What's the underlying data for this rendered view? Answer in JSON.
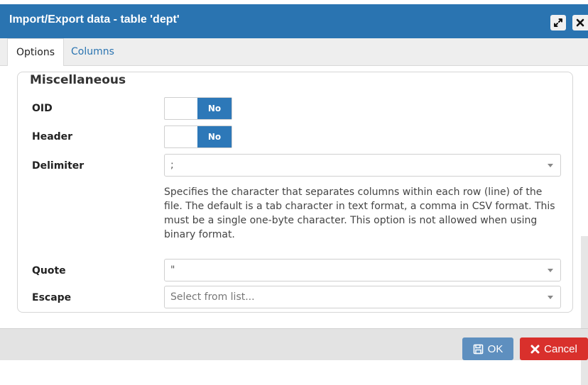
{
  "dialog": {
    "title": "Import/Export data - table 'dept'",
    "colors": {
      "titlebar": "#2a74b1",
      "accent": "#2d78b8",
      "cancel": "#d9302c",
      "ok": "#5e8fbf"
    }
  },
  "titlebar_buttons": [
    {
      "icon": "maximize-icon"
    },
    {
      "icon": "close-icon"
    }
  ],
  "tabs": [
    {
      "label": "Options",
      "active": true
    },
    {
      "label": "Columns",
      "active": false
    }
  ],
  "misc": {
    "legend": "Miscellaneous",
    "oid": {
      "label": "OID",
      "value": "No"
    },
    "header": {
      "label": "Header",
      "value": "No"
    },
    "delimiter": {
      "label": "Delimiter",
      "value": ";",
      "help": "Specifies the character that separates columns within each row (line) of the file. The default is a tab character in text format, a comma in CSV format. This must be a single one-byte character. This option is not allowed when using binary format."
    },
    "quote": {
      "label": "Quote",
      "value": "\""
    },
    "escape": {
      "label": "Escape",
      "placeholder": "Select from list..."
    }
  },
  "footer": {
    "ok_label": "OK",
    "cancel_label": "Cancel",
    "ok_icon": "save-icon",
    "cancel_icon": "close-icon"
  }
}
